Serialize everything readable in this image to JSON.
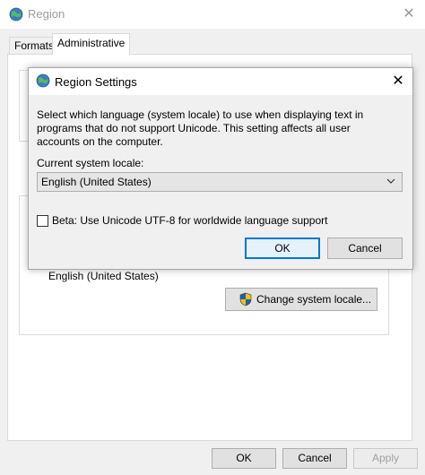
{
  "region_window": {
    "title": "Region",
    "close_glyph": "✕",
    "tabs": [
      {
        "label": "Formats"
      },
      {
        "label": "Administrative"
      }
    ],
    "current_locale_text": "English (United States)",
    "change_locale_label": "Change system locale...",
    "buttons": {
      "ok": "OK",
      "cancel": "Cancel",
      "apply": "Apply"
    }
  },
  "dialog": {
    "title": "Region Settings",
    "close_glyph": "✕",
    "description": "Select which language (system locale) to use when displaying text in programs that do not support Unicode. This setting affects all user accounts on the computer.",
    "locale_label": "Current system locale:",
    "locale_value": "English (United States)",
    "beta_label": "Beta: Use Unicode UTF-8 for worldwide language support",
    "beta_checked": false,
    "ok_label": "OK",
    "cancel_label": "Cancel"
  },
  "icons": {
    "globe": "globe-icon",
    "shield": "uac-shield-icon",
    "chevron": "chevron-down-icon"
  },
  "colors": {
    "accent": "#0078d7",
    "window_bg": "#f0f0f0",
    "titlebar_bg": "#ffffff",
    "disabled_text": "#a0a0a0"
  }
}
